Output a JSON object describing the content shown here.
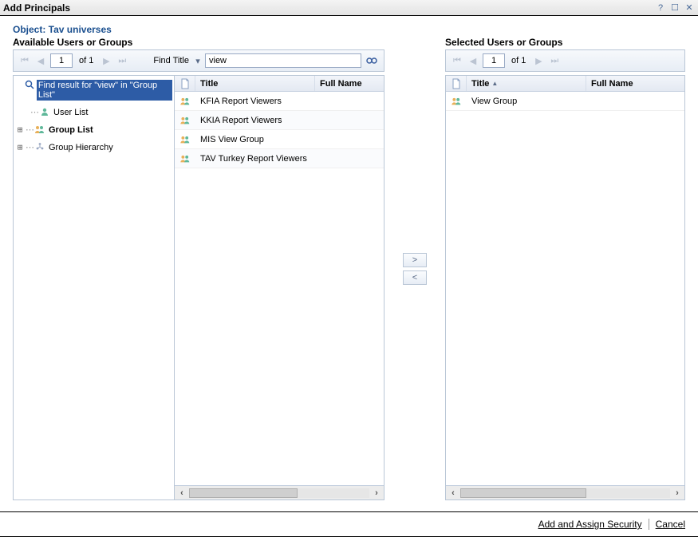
{
  "window": {
    "title": "Add Principals"
  },
  "object_label": "Object: Tav universes",
  "available": {
    "header": "Available Users or Groups",
    "pager": {
      "page": "1",
      "of_text": "of 1"
    },
    "find": {
      "label": "Find Title",
      "value": "view"
    },
    "tree": {
      "find_result": "Find result for \"view\" in \"Group List\"",
      "user_list": "User List",
      "group_list": "Group List",
      "group_hierarchy": "Group Hierarchy"
    },
    "columns": {
      "title": "Title",
      "full_name": "Full Name"
    },
    "rows": [
      {
        "title": "KFIA Report Viewers",
        "full_name": ""
      },
      {
        "title": "KKIA Report Viewers",
        "full_name": ""
      },
      {
        "title": "MIS View Group",
        "full_name": ""
      },
      {
        "title": "TAV Turkey Report Viewers",
        "full_name": ""
      }
    ]
  },
  "move": {
    "right": ">",
    "left": "<"
  },
  "selected": {
    "header": "Selected Users or Groups",
    "pager": {
      "page": "1",
      "of_text": "of 1"
    },
    "columns": {
      "title": "Title",
      "full_name": "Full Name"
    },
    "rows": [
      {
        "title": "View Group",
        "full_name": ""
      }
    ]
  },
  "footer": {
    "add_assign": "Add and Assign Security",
    "cancel": "Cancel"
  }
}
